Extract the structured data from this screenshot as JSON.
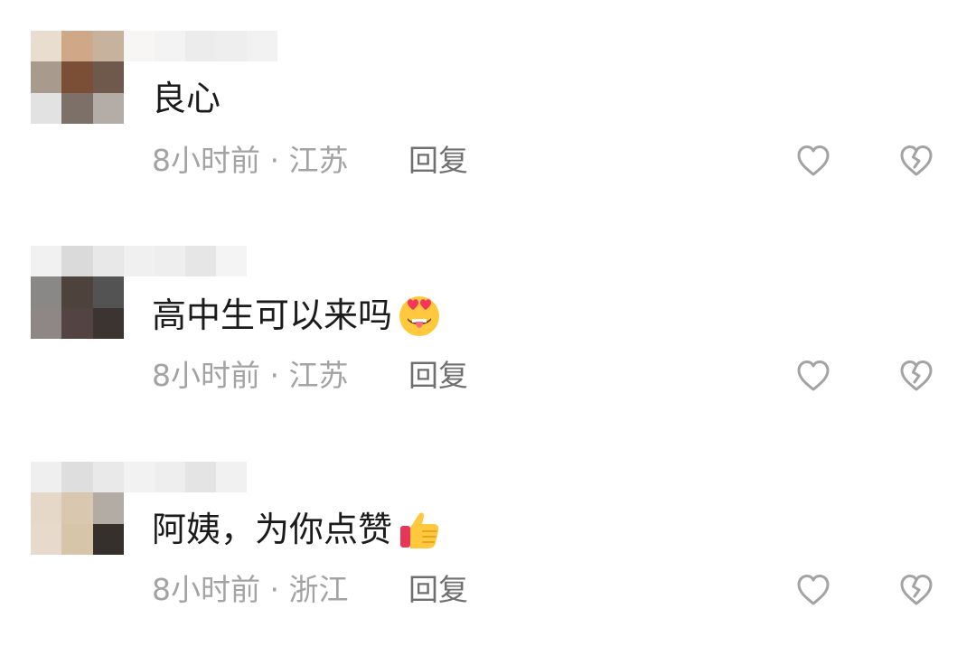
{
  "comments": [
    {
      "text": "良心",
      "time_location": "8小时前 · 江苏",
      "reply_label": "回复",
      "emoji": "",
      "avatar_colors": [
        "#e9ddd0",
        "#cfa987",
        "#c7b29e",
        "#a99a8e",
        "#7b4f35",
        "#6e594c",
        "#e2e2e2",
        "#7c7069",
        "#b3aca7"
      ],
      "username_colors": [
        "#f8f6f4",
        "#f3f3f3",
        "#ececec",
        "#eeeeee",
        "#f2f2f2"
      ]
    },
    {
      "text": "高中生可以来吗",
      "time_location": "8小时前 · 江苏",
      "reply_label": "回复",
      "emoji": "heart-eyes-tongue-emoji",
      "avatar_colors": [
        "#f1f1f1",
        "#dadada",
        "#e8e8e8",
        "#8a8886",
        "#4e423d",
        "#535353",
        "#8f8786",
        "#534443",
        "#3b3431"
      ],
      "username_colors": [
        "#f0f0f0",
        "#eeeeee",
        "#e6e6e6",
        "#f4f4f4"
      ]
    },
    {
      "text": "阿姨，为你点赞",
      "time_location": "8小时前 · 浙江",
      "reply_label": "回复",
      "emoji": "thumbs-up-emoji",
      "avatar_colors": [
        "#efefef",
        "#dedede",
        "#e9e9e9",
        "#e6d8c9",
        "#d9c7b0",
        "#b3aca4",
        "#e7d9cb",
        "#d7c5a9",
        "#35302c"
      ],
      "username_colors": [
        "#f2f2f2",
        "#eeeeee",
        "#e4e4e4",
        "#f1f1f1"
      ]
    }
  ],
  "icons": {
    "like": "heart-outline-icon",
    "dislike": "broken-heart-outline-icon"
  },
  "colors": {
    "text": "#1b1b1b",
    "meta": "#a3a3a3",
    "reply": "#6f6f6f",
    "icon": "#a3a3a3"
  }
}
